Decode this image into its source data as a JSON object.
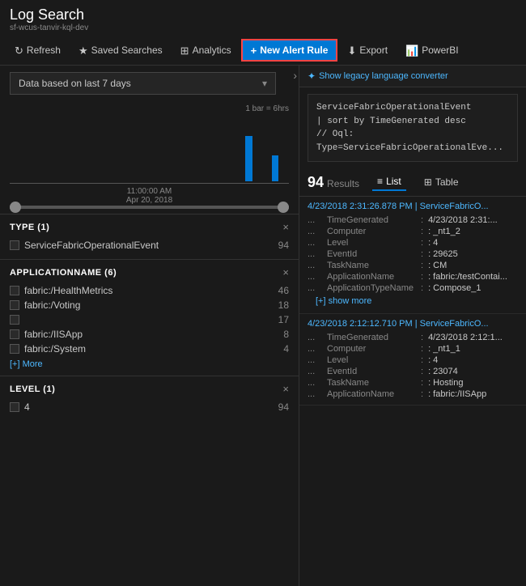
{
  "header": {
    "title": "Log Search",
    "subtitle": "sf-wcus-tanvir-kql-dev"
  },
  "toolbar": {
    "refresh_label": "Refresh",
    "saved_searches_label": "Saved Searches",
    "analytics_label": "Analytics",
    "new_alert_label": "New Alert Rule",
    "export_label": "Export",
    "powerbi_label": "PowerBI"
  },
  "left_panel": {
    "date_range": {
      "text": "Data based on last 7 days",
      "arrow": "▾"
    },
    "chart": {
      "bar_label": "1 bar = 6hrs",
      "timestamp_line1": "11:00:00 AM",
      "timestamp_line2": "Apr 20, 2018"
    },
    "filters": [
      {
        "id": "type",
        "title": "TYPE  (1)",
        "items": [
          {
            "label": "ServiceFabricOperationalEvent",
            "count": "94",
            "checked": false
          }
        ],
        "show_more": null
      },
      {
        "id": "applicationname",
        "title": "APPLICATIONNAME  (6)",
        "items": [
          {
            "label": "fabric:/HealthMetrics",
            "count": "46",
            "checked": false
          },
          {
            "label": "fabric:/Voting",
            "count": "18",
            "checked": false
          },
          {
            "label": "",
            "count": "17",
            "checked": false
          },
          {
            "label": "fabric:/IISApp",
            "count": "8",
            "checked": false
          },
          {
            "label": "fabric:/System",
            "count": "4",
            "checked": false
          }
        ],
        "show_more": "[+] More"
      },
      {
        "id": "level",
        "title": "LEVEL  (1)",
        "items": [
          {
            "label": "4",
            "count": "94",
            "checked": false
          }
        ],
        "show_more": null
      }
    ]
  },
  "right_panel": {
    "legacy_label": "Show legacy language converter",
    "query_lines": [
      "ServiceFabricOperationalEvent",
      "| sort by TimeGenerated desc",
      "// Oql: Type=ServiceFabricOperationalEve..."
    ],
    "results": {
      "count": "94",
      "label": "Results"
    },
    "views": [
      {
        "label": "List",
        "icon": "≡",
        "active": true
      },
      {
        "label": "Table",
        "icon": "⊞",
        "active": false
      }
    ],
    "log_entries": [
      {
        "header": "4/23/2018 2:31:26.878 PM | ServiceFabricO...",
        "fields": [
          {
            "name": "TimeGenerated",
            "value": "4/23/2018 2:31:..."
          },
          {
            "name": "Computer",
            "value": ": _nt1_2"
          },
          {
            "name": "Level",
            "value": ": 4"
          },
          {
            "name": "EventId",
            "value": ": 29625"
          },
          {
            "name": "TaskName",
            "value": ": CM"
          },
          {
            "name": "ApplicationName",
            "value": ": fabric:/testContai..."
          },
          {
            "name": "ApplicationTypeName",
            "value": ": Compose_1"
          }
        ],
        "show_more": "[+] show more"
      },
      {
        "header": "4/23/2018 2:12:12.710 PM | ServiceFabricO...",
        "fields": [
          {
            "name": "TimeGenerated",
            "value": "4/23/2018 2:12:1..."
          },
          {
            "name": "Computer",
            "value": ": _nt1_1"
          },
          {
            "name": "Level",
            "value": ": 4"
          },
          {
            "name": "EventId",
            "value": ": 23074"
          },
          {
            "name": "TaskName",
            "value": ": Hosting"
          },
          {
            "name": "ApplicationName",
            "value": ": fabric:/IISApp"
          }
        ],
        "show_more": null
      }
    ]
  },
  "icons": {
    "refresh": "↻",
    "star": "★",
    "analytics": "⊞",
    "plus": "+",
    "download": "⬇",
    "powerbi": "📊",
    "check": "✓",
    "arrow_right": "›",
    "collapse": "›",
    "close": "×",
    "list": "≡",
    "table": "⊞",
    "legacy": "✦"
  },
  "colors": {
    "accent": "#0078d4",
    "alert_border": "#ff4444",
    "link": "#4db8ff"
  }
}
